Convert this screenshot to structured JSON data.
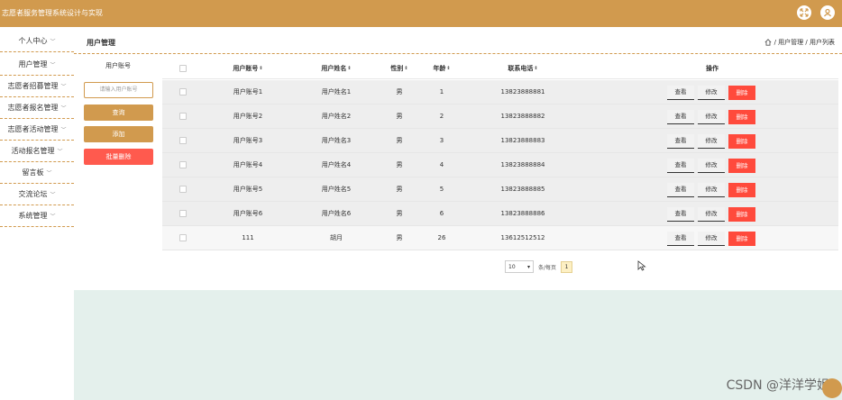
{
  "app": {
    "title": "志愿者服务管理系统设计与实现",
    "accent_color": "#d19a4e",
    "icons": [
      "expand-icon",
      "user-avatar-icon"
    ]
  },
  "sidebar": {
    "items": [
      {
        "label": "个人中心"
      },
      {
        "label": "用户管理"
      },
      {
        "label": "志愿者招募管理"
      },
      {
        "label": "志愿者报名管理"
      },
      {
        "label": "志愿者活动管理"
      },
      {
        "label": "活动报名管理"
      },
      {
        "label": "留言板"
      },
      {
        "label": "交流论坛"
      },
      {
        "label": "系统管理"
      }
    ]
  },
  "header": {
    "page_title": "用户管理",
    "breadcrumb": "/ 用户管理 / 用户列表"
  },
  "filter": {
    "label": "用户账号",
    "placeholder": "请输入用户账号",
    "query_label": "查询",
    "add_label": "添加",
    "batch_delete_label": "批量删除"
  },
  "table": {
    "columns": [
      "用户账号",
      "用户姓名",
      "性别",
      "年龄",
      "联系电话",
      "操作"
    ],
    "rows": [
      {
        "account": "用户账号1",
        "name": "用户姓名1",
        "gender": "男",
        "age": "1",
        "phone": "13823888881"
      },
      {
        "account": "用户账号2",
        "name": "用户姓名2",
        "gender": "男",
        "age": "2",
        "phone": "13823888882"
      },
      {
        "account": "用户账号3",
        "name": "用户姓名3",
        "gender": "男",
        "age": "3",
        "phone": "13823888883"
      },
      {
        "account": "用户账号4",
        "name": "用户姓名4",
        "gender": "男",
        "age": "4",
        "phone": "13823888884"
      },
      {
        "account": "用户账号5",
        "name": "用户姓名5",
        "gender": "男",
        "age": "5",
        "phone": "13823888885"
      },
      {
        "account": "用户账号6",
        "name": "用户姓名6",
        "gender": "男",
        "age": "6",
        "phone": "13823888886"
      },
      {
        "account": "111",
        "name": "胡月",
        "gender": "男",
        "age": "26",
        "phone": "13612512512"
      }
    ],
    "actions": {
      "view": "查看",
      "edit": "修改",
      "delete": "删除"
    }
  },
  "pagination": {
    "page_size": "10",
    "per_page_label": "条/每页",
    "current_page": "1"
  },
  "watermark": "CSDN @洋洋学姐"
}
